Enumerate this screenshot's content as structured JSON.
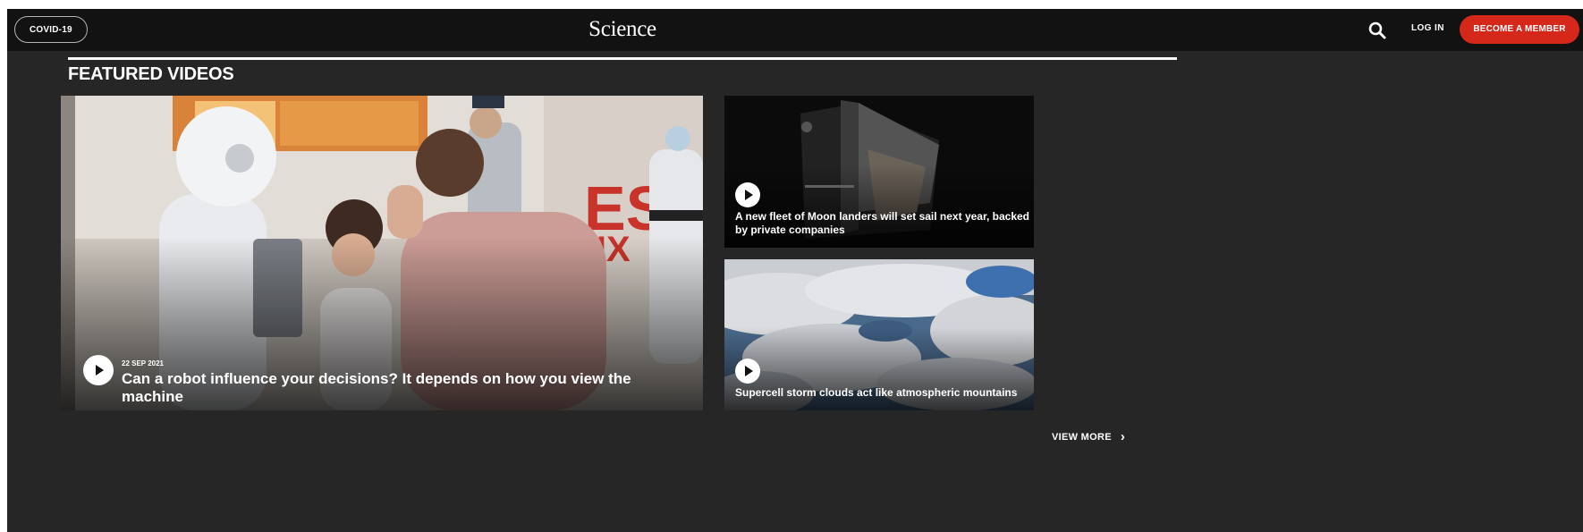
{
  "nav": {
    "covid_label": "COVID-19",
    "brand": "Science",
    "search_icon": "search-icon",
    "login_label": "LOG IN",
    "member_label": "BECOME A MEMBER",
    "accent_color": "#d5281b"
  },
  "section": {
    "title": "FEATURED VIDEOS"
  },
  "videos": [
    {
      "date": "22 SEP 2021",
      "title": "Can a robot influence your decisions? It depends on how you view the machine",
      "icon": "play-icon"
    },
    {
      "title": "A new fleet of Moon landers will set sail next year, backed by private companies",
      "icon": "play-icon"
    },
    {
      "title": "Supercell storm clouds act like atmospheric mountains",
      "icon": "play-icon"
    }
  ],
  "view_more": {
    "label": "VIEW MORE",
    "icon": "chevron-right-icon"
  }
}
